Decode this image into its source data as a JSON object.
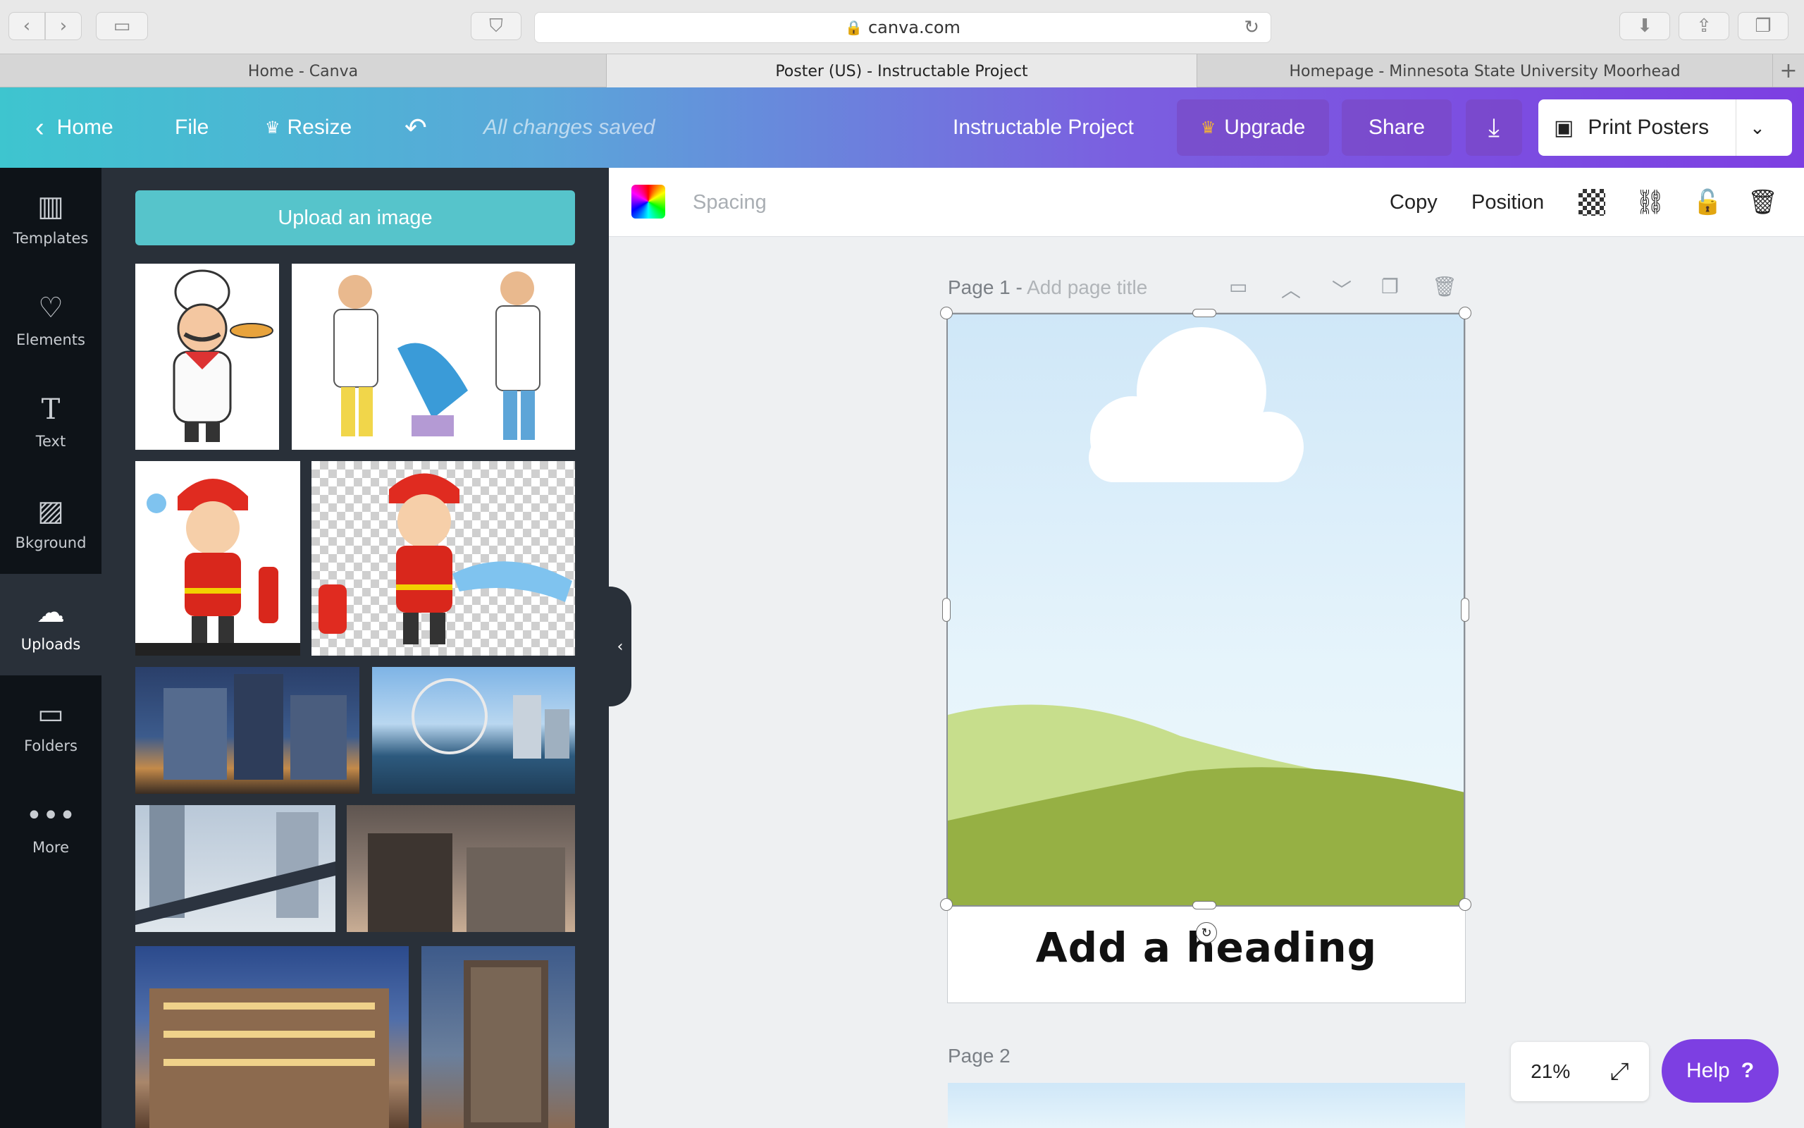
{
  "browser": {
    "url": "canva.com",
    "tabs": [
      {
        "label": "Home - Canva"
      },
      {
        "label": "Poster (US) - Instructable Project"
      },
      {
        "label": "Homepage - Minnesota State University Moorhead"
      }
    ]
  },
  "header": {
    "home": "Home",
    "file": "File",
    "resize": "Resize",
    "status": "All changes saved",
    "project_title": "Instructable Project",
    "upgrade": "Upgrade",
    "share": "Share",
    "print": "Print Posters"
  },
  "rail": {
    "items": [
      {
        "label": "Templates",
        "icon": "templates-icon"
      },
      {
        "label": "Elements",
        "icon": "elements-icon"
      },
      {
        "label": "Text",
        "icon": "text-icon"
      },
      {
        "label": "Bkground",
        "icon": "background-icon"
      },
      {
        "label": "Uploads",
        "icon": "upload-cloud-icon"
      },
      {
        "label": "Folders",
        "icon": "folder-icon"
      },
      {
        "label": "More",
        "icon": "more-dots-icon"
      }
    ]
  },
  "panel": {
    "upload_label": "Upload an image"
  },
  "toolbar": {
    "spacing": "Spacing",
    "copy": "Copy",
    "position": "Position"
  },
  "canvas": {
    "page1_label": "Page 1 - ",
    "page1_title_placeholder": "Add page title",
    "heading": "Add a heading",
    "page2_label": "Page 2"
  },
  "footer": {
    "zoom": "21%",
    "help": "Help",
    "help_mark": "?"
  },
  "colors": {
    "accent_purple": "#7d3fe2",
    "upload_teal": "#56c4cb",
    "panel_bg": "#293039",
    "rail_bg": "#0e1318"
  }
}
